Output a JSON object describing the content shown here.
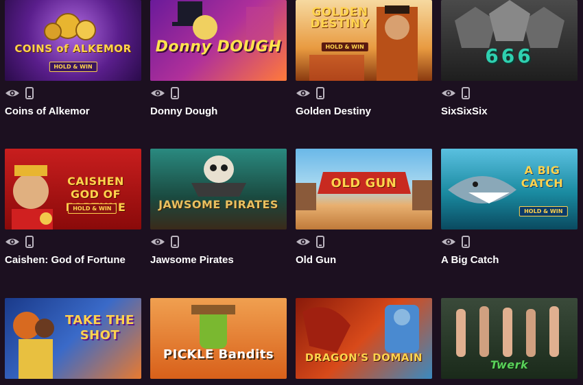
{
  "colors": {
    "background": "#1c1020",
    "title_text": "#ffffff",
    "icon": "#bcb6c0"
  },
  "icons": {
    "preview": "eye-icon",
    "device": "mobile-icon"
  },
  "games": [
    {
      "title": "Coins of Alkemor",
      "logo": "COINS of ALKEMOR",
      "tag": "HOLD & WIN"
    },
    {
      "title": "Donny Dough",
      "logo": "Donny DOUGH",
      "tag": ""
    },
    {
      "title": "Golden Destiny",
      "logo": "GOLDEN DESTINY",
      "tag": "HOLD & WIN"
    },
    {
      "title": "SixSixSix",
      "logo": "666",
      "tag": ""
    },
    {
      "title": "Caishen: God of Fortune",
      "logo": "CAISHEN GOD OF FORTUNE",
      "tag": "HOLD & WIN"
    },
    {
      "title": "Jawsome Pirates",
      "logo": "JAWSOME PIRATES",
      "tag": ""
    },
    {
      "title": "Old Gun",
      "logo": "OLD GUN",
      "tag": ""
    },
    {
      "title": "A Big Catch",
      "logo": "A BIG CATCH",
      "tag": "HOLD & WIN"
    },
    {
      "title": "",
      "logo": "TAKE THE SHOT",
      "tag": ""
    },
    {
      "title": "",
      "logo": "PICKLE Bandits",
      "tag": ""
    },
    {
      "title": "",
      "logo": "DRAGON'S DOMAIN",
      "tag": ""
    },
    {
      "title": "",
      "logo": "Twerk",
      "tag": ""
    }
  ]
}
